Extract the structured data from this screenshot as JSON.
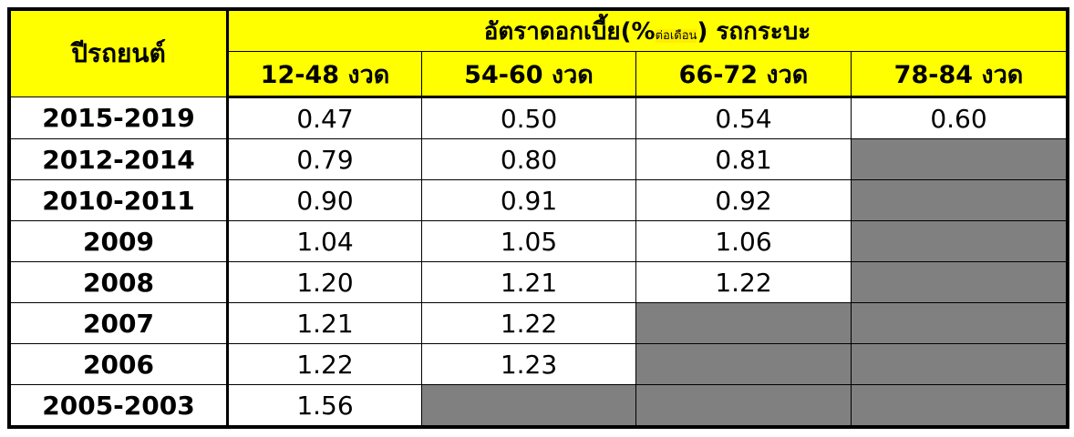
{
  "table": {
    "year_header": "ปีรถยนต์",
    "rate_header_main": "อัตราดอกเบี้ย(%",
    "rate_header_small": "ต่อเดือน",
    "rate_header_end": ") รถกระบะ",
    "columns": [
      "12-48 งวด",
      "54-60 งวด",
      "66-72 งวด",
      "78-84 งวด"
    ],
    "empty_cell_color": "#808080",
    "header_color": "#ffff00",
    "rows": [
      {
        "year": "2015-2019",
        "values": [
          "0.47",
          "0.50",
          "0.54",
          "0.60"
        ]
      },
      {
        "year": "2012-2014",
        "values": [
          "0.79",
          "0.80",
          "0.81",
          null
        ]
      },
      {
        "year": "2010-2011",
        "values": [
          "0.90",
          "0.91",
          "0.92",
          null
        ]
      },
      {
        "year": "2009",
        "values": [
          "1.04",
          "1.05",
          "1.06",
          null
        ]
      },
      {
        "year": "2008",
        "values": [
          "1.20",
          "1.21",
          "1.22",
          null
        ]
      },
      {
        "year": "2007",
        "values": [
          "1.21",
          "1.22",
          null,
          null
        ]
      },
      {
        "year": "2006",
        "values": [
          "1.22",
          "1.23",
          null,
          null
        ]
      },
      {
        "year": "2005-2003",
        "values": [
          "1.56",
          null,
          null,
          null
        ]
      }
    ]
  }
}
